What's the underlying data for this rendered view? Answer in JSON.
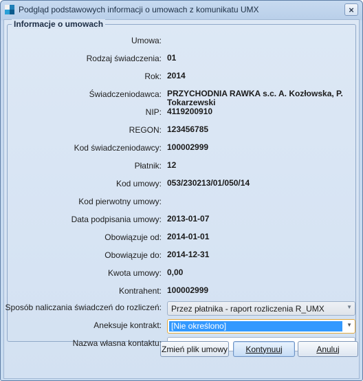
{
  "window": {
    "title": "Podgląd podstawowych informacji o umowach z komunikatu UMX",
    "close_label": "×"
  },
  "group": {
    "title": "Informacje o umowach"
  },
  "fields": [
    {
      "label": "Umowa:",
      "value": ""
    },
    {
      "label": "Rodzaj świadczenia:",
      "value": "01"
    },
    {
      "label": "Rok:",
      "value": "2014"
    },
    {
      "label": "Świadczeniodawca:",
      "value": "PRZYCHODNIA RAWKA s.c. A. Kozłowska, P. Tokarzewski"
    },
    {
      "label": "NIP:",
      "value": "4119200910"
    },
    {
      "label": "REGON:",
      "value": "123456785"
    },
    {
      "label": "Kod świadczeniodawcy:",
      "value": "100002999"
    },
    {
      "label": "Płatnik:",
      "value": "12"
    },
    {
      "label": "Kod umowy:",
      "value": "053/230213/01/050/14"
    },
    {
      "label": "Kod pierwotny umowy:",
      "value": ""
    },
    {
      "label": "Data podpisania umowy:",
      "value": "2013-01-07"
    },
    {
      "label": "Obowiązuje od:",
      "value": "2014-01-01"
    },
    {
      "label": "Obowiązuje do:",
      "value": "2014-12-31"
    },
    {
      "label": "Kwota umowy:",
      "value": "0,00"
    },
    {
      "label": "Kontrahent:",
      "value": "100002999"
    }
  ],
  "settlement": {
    "label": "Sposób naliczania świadczeń do rozliczeń:",
    "value": "Przez płatnika - raport rozliczenia R_UMX"
  },
  "annex": {
    "label": "Aneksuje kontrakt:",
    "value": "[Nie określono]"
  },
  "own_name": {
    "label": "Nazwa własna kontaktu:",
    "value": "",
    "clear_icon": "×"
  },
  "buttons": {
    "change_file": "Zmień plik umowy",
    "continue": "Kontynuuj",
    "cancel": "Anuluj"
  }
}
